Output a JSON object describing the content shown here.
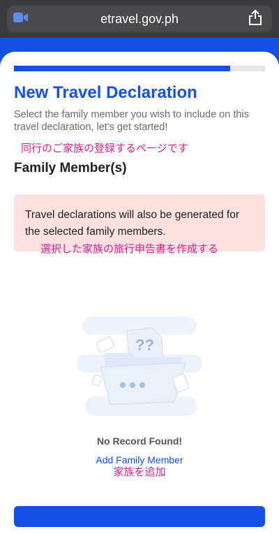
{
  "browser": {
    "url": "etravel.gov.ph",
    "left_icon": "video-camera-icon",
    "right_icon": "share-icon"
  },
  "progress": {
    "value": 0.86
  },
  "page": {
    "title": "New Travel Declaration",
    "subtitle": "Select the family member you wish to include on this travel declaration, let's get started!",
    "annotation_1": "同行のご家族の登録するページです",
    "section_title": "Family Member(s)",
    "notice_text": "Travel declarations will also be generated for the selected family members.",
    "annotation_2": "選択した家族の旅行申告書を作成する",
    "empty_illustration": "empty-folder-illustration",
    "empty_text": "No Record Found!",
    "add_link": "Add Family Member",
    "annotation_3": "家族を追加"
  },
  "colors": {
    "brand": "#1450e6",
    "annotation": "#e0208c",
    "notice_bg": "#fde0e0"
  }
}
